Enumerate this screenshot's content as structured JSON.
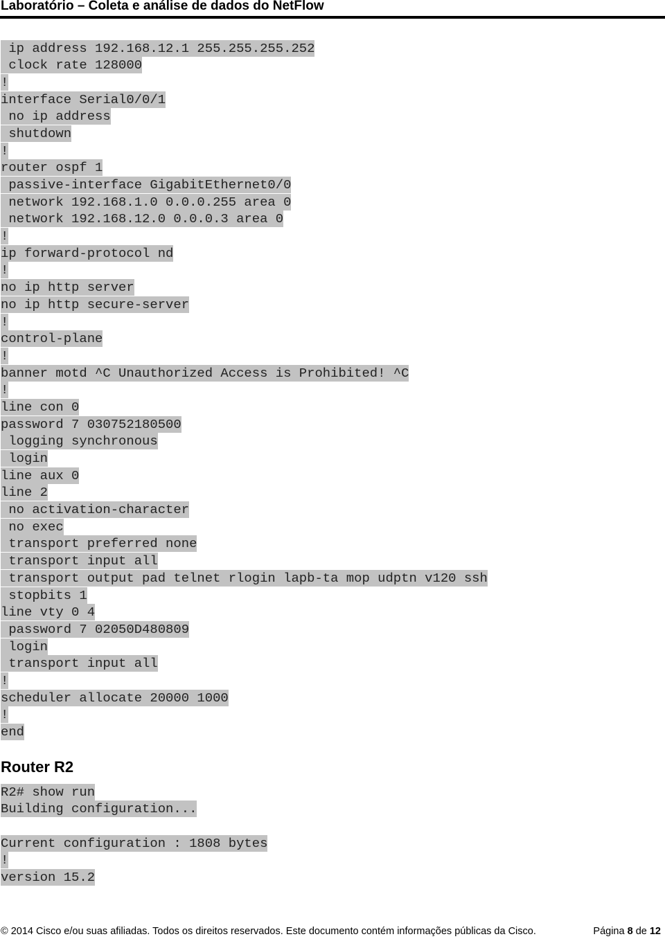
{
  "header": {
    "title": "Laboratório – Coleta e análise de dados do NetFlow"
  },
  "config_r1_tail": [
    " ip address 192.168.12.1 255.255.255.252",
    " clock rate 128000",
    "!",
    "interface Serial0/0/1",
    " no ip address",
    " shutdown",
    "!",
    "router ospf 1",
    " passive-interface GigabitEthernet0/0",
    " network 192.168.1.0 0.0.0.255 area 0",
    " network 192.168.12.0 0.0.0.3 area 0",
    "!",
    "ip forward-protocol nd",
    "!",
    "no ip http server",
    "no ip http secure-server",
    "!",
    "control-plane",
    "!",
    "banner motd ^C Unauthorized Access is Prohibited! ^C",
    "!",
    "line con 0",
    "password 7 030752180500",
    " logging synchronous",
    " login",
    "line aux 0",
    "line 2",
    " no activation-character",
    " no exec",
    " transport preferred none",
    " transport input all",
    " transport output pad telnet rlogin lapb-ta mop udptn v120 ssh",
    " stopbits 1",
    "line vty 0 4",
    " password 7 02050D480809",
    " login",
    " transport input all",
    "!",
    "scheduler allocate 20000 1000",
    "!",
    "end"
  ],
  "section_r2": {
    "heading": "Router R2"
  },
  "config_r2": [
    "R2# show run",
    "Building configuration...",
    "",
    "Current configuration : 1808 bytes",
    "!",
    "version 15.2"
  ],
  "footer": {
    "copyright": "© 2014 Cisco e/ou suas afiliadas. Todos os direitos reservados. Este documento contém informações públicas da Cisco.",
    "page_prefix": "Página ",
    "page_current": "8",
    "page_sep": " de ",
    "page_total": "12"
  }
}
